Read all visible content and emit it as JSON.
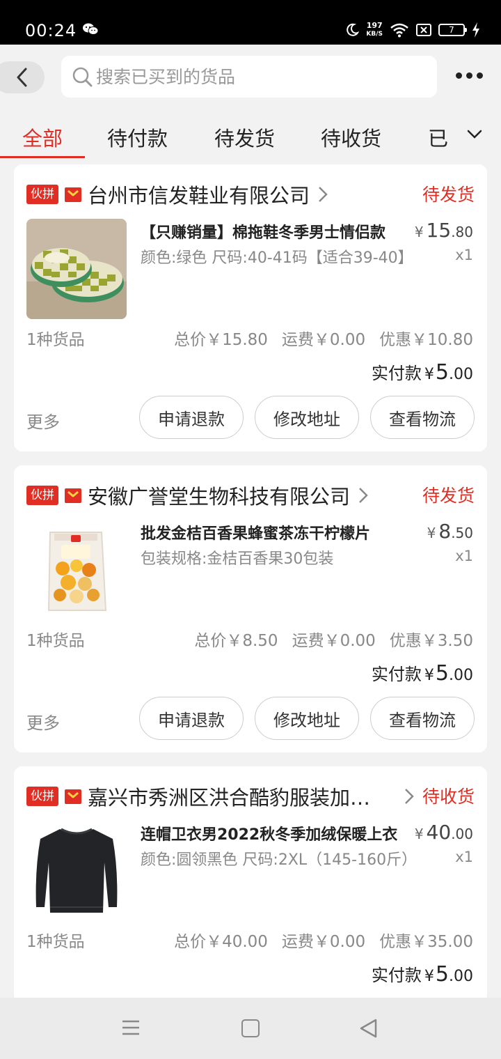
{
  "status_bar": {
    "time": "00:24",
    "net_speed_value": "197",
    "net_speed_unit": "KB/S",
    "battery": "7"
  },
  "search": {
    "placeholder": "搜索已买到的货品"
  },
  "tabs": [
    {
      "label": "全部",
      "active": true
    },
    {
      "label": "待付款",
      "active": false
    },
    {
      "label": "待发货",
      "active": false
    },
    {
      "label": "待收货",
      "active": false
    },
    {
      "label": "已",
      "active": false
    }
  ],
  "badge_label": "伙拼",
  "more_label": "更多",
  "paid_label": "实付款",
  "yen": "¥",
  "orders": [
    {
      "shop": "台州市信发鞋业有限公司",
      "status": "待发货",
      "item_title": "【只赚销量】棉拖鞋冬季男士情侣款",
      "item_spec": "颜色:绿色 尺码:40-41码【适合39-40】",
      "price_int": "15",
      "price_dec": ".80",
      "qty": "x1",
      "count": "1种货品",
      "total": "总价￥15.80",
      "shipping": "运费￥0.00",
      "discount": "优惠￥10.80",
      "paid_int": "5",
      "paid_dec": ".00",
      "buttons": [
        "申请退款",
        "修改地址",
        "查看物流"
      ]
    },
    {
      "shop": "安徽广誉堂生物科技有限公司",
      "status": "待发货",
      "item_title": "批发金桔百香果蜂蜜茶冻干柠檬片",
      "item_spec": "包装规格:金桔百香果30包装",
      "price_int": "8",
      "price_dec": ".50",
      "qty": "x1",
      "count": "1种货品",
      "total": "总价￥8.50",
      "shipping": "运费￥0.00",
      "discount": "优惠￥3.50",
      "paid_int": "5",
      "paid_dec": ".00",
      "buttons": [
        "申请退款",
        "修改地址",
        "查看物流"
      ]
    },
    {
      "shop": "嘉兴市秀洲区洪合酷豹服装加工厂",
      "status": "待收货",
      "item_title": "连帽卫衣男2022秋冬季加绒保暖上衣",
      "item_spec": "颜色:圆领黑色 尺码:2XL（145-160斤）",
      "price_int": "40",
      "price_dec": ".00",
      "qty": "x1",
      "count": "1种货品",
      "total": "总价￥40.00",
      "shipping": "运费￥0.00",
      "discount": "优惠￥35.00",
      "paid_int": "5",
      "paid_dec": ".00",
      "buttons": []
    }
  ],
  "colors": {
    "accent": "#e02e24",
    "background": "#f2f2f2"
  },
  "icons": [
    "wechat-icon",
    "moon-icon",
    "wifi-icon",
    "sim-icon",
    "battery-icon",
    "charging-icon",
    "back-arrow-icon",
    "search-icon",
    "more-dots-icon",
    "chevron-down-icon",
    "gift-icon",
    "chevron-right-icon",
    "nav-menu-icon",
    "nav-home-icon",
    "nav-back-icon"
  ]
}
